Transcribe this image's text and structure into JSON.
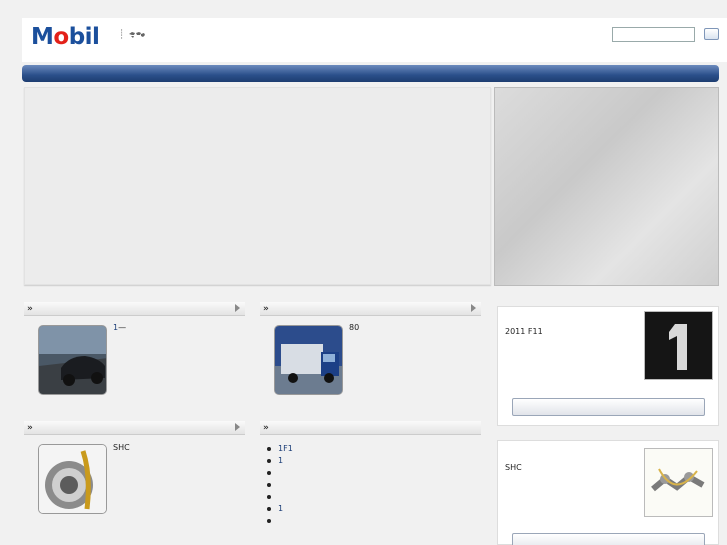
{
  "header": {
    "logo": "Mobil",
    "util_left": "",
    "util_sep": "┊",
    "util_right": "",
    "search_placeholder": "",
    "search_button": "",
    "languages": [
      "",
      "",
      "",
      "",
      ""
    ]
  },
  "nav": {
    "items": [
      "",
      "",
      "",
      "",
      "",
      ""
    ]
  },
  "hero": {
    "title": "",
    "p1_a": "",
    "p1_link": "",
    "p1_b": "",
    "p1_link2": "",
    "p1_c": "",
    "p2": ""
  },
  "sections": [
    {
      "title": "",
      "text_a": "",
      "text_link": "1",
      "text_b": "—"
    },
    {
      "title": "",
      "text": "80"
    },
    {
      "title": "",
      "text": "SHC"
    },
    {
      "title": "",
      "items": [
        "1F1",
        "1",
        "",
        "",
        "",
        "1",
        ""
      ]
    }
  ],
  "side_cards": [
    {
      "title": "",
      "text": "2011 F11",
      "button": ""
    },
    {
      "title": "",
      "text": "SHC",
      "button": ""
    }
  ],
  "colors": {
    "brand_blue": "#1b4f9c",
    "brand_red": "#e32119",
    "link": "#1b3d77",
    "nav_bar": "#2a4f8a"
  }
}
